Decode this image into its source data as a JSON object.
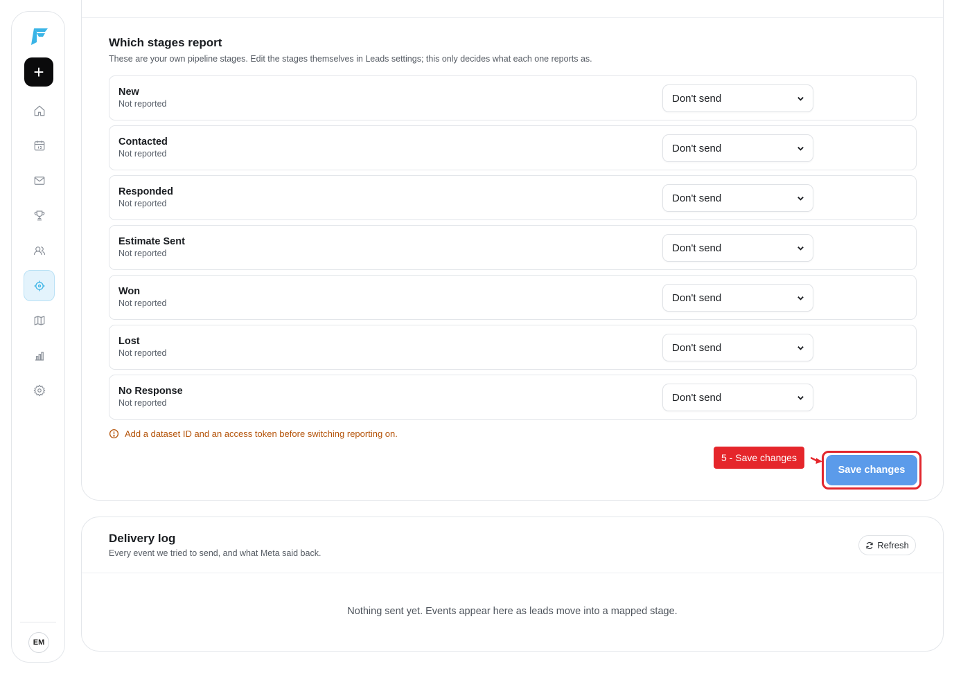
{
  "sidebar": {
    "new_label": "+",
    "avatar_initials": "EM",
    "items": [
      {
        "name": "home-icon",
        "active": false
      },
      {
        "name": "calendar-icon",
        "active": false
      },
      {
        "name": "mail-icon",
        "active": false
      },
      {
        "name": "trophy-icon",
        "active": false
      },
      {
        "name": "users-icon",
        "active": false
      },
      {
        "name": "crosshair-icon",
        "active": true
      },
      {
        "name": "map-icon",
        "active": false
      },
      {
        "name": "bar-chart-icon",
        "active": false
      },
      {
        "name": "settings-icon",
        "active": false
      }
    ],
    "accent_color": "#3ab4e6"
  },
  "stages_section": {
    "title": "Which stages report",
    "subtitle": "These are your own pipeline stages. Edit the stages themselves in Leads settings; this only decides what each one reports as.",
    "stages": [
      {
        "name": "New",
        "status": "Not reported",
        "selected": "Don't send"
      },
      {
        "name": "Contacted",
        "status": "Not reported",
        "selected": "Don't send"
      },
      {
        "name": "Responded",
        "status": "Not reported",
        "selected": "Don't send"
      },
      {
        "name": "Estimate Sent",
        "status": "Not reported",
        "selected": "Don't send"
      },
      {
        "name": "Won",
        "status": "Not reported",
        "selected": "Don't send"
      },
      {
        "name": "Lost",
        "status": "Not reported",
        "selected": "Don't send"
      },
      {
        "name": "No Response",
        "status": "Not reported",
        "selected": "Don't send"
      }
    ],
    "warning": "Add a dataset ID and an access token before switching reporting on.",
    "warning_color": "#b45309",
    "save_label": "Save changes",
    "save_color": "#5b9bea",
    "callout_label": "5 - Save changes",
    "callout_color": "#e5262b"
  },
  "delivery_log": {
    "title": "Delivery log",
    "subtitle": "Every event we tried to send, and what Meta said back.",
    "refresh_label": "Refresh",
    "empty_text": "Nothing sent yet. Events appear here as leads move into a mapped stage."
  }
}
